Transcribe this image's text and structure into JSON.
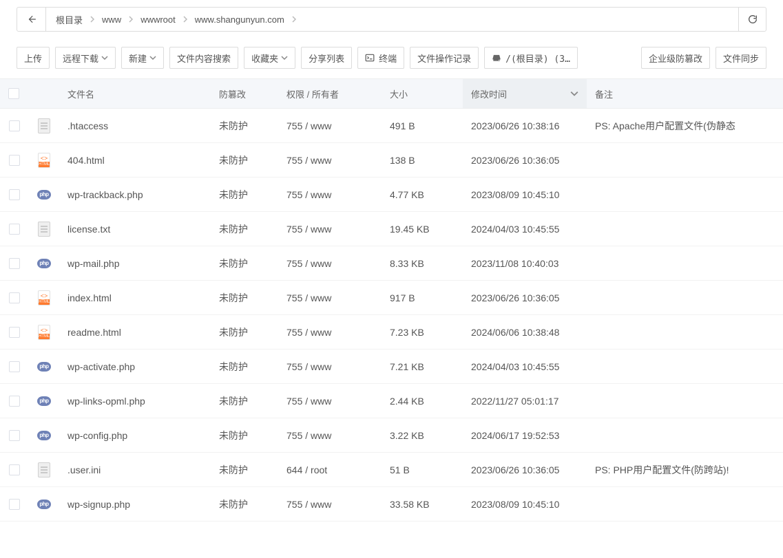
{
  "breadcrumbs": [
    "根目录",
    "www",
    "wwwroot",
    "www.shangunyun.com"
  ],
  "toolbar": {
    "upload": "上传",
    "remote_download": "远程下载",
    "new": "新建",
    "content_search": "文件内容搜索",
    "favorites": "收藏夹",
    "share_list": "分享列表",
    "terminal": "终端",
    "file_op_log": "文件操作记录",
    "disk": "/(根目录) (3…",
    "anti_tamper_enterprise": "企业级防篡改",
    "file_sync": "文件同步"
  },
  "columns": {
    "name": "文件名",
    "tamper": "防篡改",
    "perm": "权限 / 所有者",
    "size": "大小",
    "mtime": "修改时间",
    "remark": "备注"
  },
  "rows": [
    {
      "icon": "generic",
      "name": ".htaccess",
      "tamper": "未防护",
      "perm": "755 / www",
      "size": "491 B",
      "mtime": "2023/06/26 10:38:16",
      "remark": "PS: Apache用户配置文件(伪静态"
    },
    {
      "icon": "html",
      "name": "404.html",
      "tamper": "未防护",
      "perm": "755 / www",
      "size": "138 B",
      "mtime": "2023/06/26 10:36:05",
      "remark": ""
    },
    {
      "icon": "php",
      "name": "wp-trackback.php",
      "tamper": "未防护",
      "perm": "755 / www",
      "size": "4.77 KB",
      "mtime": "2023/08/09 10:45:10",
      "remark": ""
    },
    {
      "icon": "generic",
      "name": "license.txt",
      "tamper": "未防护",
      "perm": "755 / www",
      "size": "19.45 KB",
      "mtime": "2024/04/03 10:45:55",
      "remark": ""
    },
    {
      "icon": "php",
      "name": "wp-mail.php",
      "tamper": "未防护",
      "perm": "755 / www",
      "size": "8.33 KB",
      "mtime": "2023/11/08 10:40:03",
      "remark": ""
    },
    {
      "icon": "html",
      "name": "index.html",
      "tamper": "未防护",
      "perm": "755 / www",
      "size": "917 B",
      "mtime": "2023/06/26 10:36:05",
      "remark": ""
    },
    {
      "icon": "html",
      "name": "readme.html",
      "tamper": "未防护",
      "perm": "755 / www",
      "size": "7.23 KB",
      "mtime": "2024/06/06 10:38:48",
      "remark": ""
    },
    {
      "icon": "php",
      "name": "wp-activate.php",
      "tamper": "未防护",
      "perm": "755 / www",
      "size": "7.21 KB",
      "mtime": "2024/04/03 10:45:55",
      "remark": ""
    },
    {
      "icon": "php",
      "name": "wp-links-opml.php",
      "tamper": "未防护",
      "perm": "755 / www",
      "size": "2.44 KB",
      "mtime": "2022/11/27 05:01:17",
      "remark": ""
    },
    {
      "icon": "php",
      "name": "wp-config.php",
      "tamper": "未防护",
      "perm": "755 / www",
      "size": "3.22 KB",
      "mtime": "2024/06/17 19:52:53",
      "remark": ""
    },
    {
      "icon": "generic",
      "name": ".user.ini",
      "tamper": "未防护",
      "perm": "644 / root",
      "size": "51 B",
      "mtime": "2023/06/26 10:36:05",
      "remark": "PS: PHP用户配置文件(防跨站)!"
    },
    {
      "icon": "php",
      "name": "wp-signup.php",
      "tamper": "未防护",
      "perm": "755 / www",
      "size": "33.58 KB",
      "mtime": "2023/08/09 10:45:10",
      "remark": ""
    }
  ]
}
